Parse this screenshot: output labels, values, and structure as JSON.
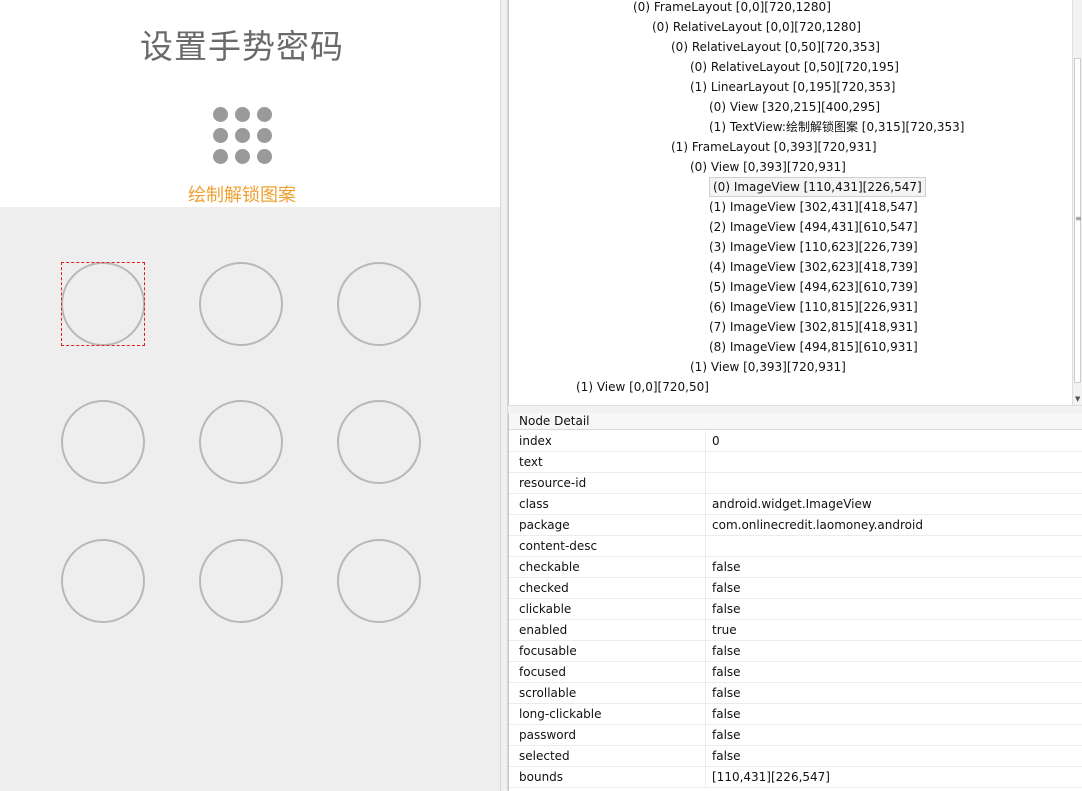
{
  "device": {
    "title": "设置手势密码",
    "hint": "绘制解锁图案",
    "pattern_nodes": 9,
    "colors": {
      "hint": "#f0a033",
      "title": "#6a6a6a",
      "node_border": "#b8b8b8",
      "pattern_bg": "#eeeeee",
      "selection": "#e02020"
    }
  },
  "tree": {
    "lines": [
      {
        "text": "(0) FrameLayout [0,0][720,1280]"
      },
      {
        "text": "(0) RelativeLayout [0,0][720,1280]"
      },
      {
        "text": "(0) RelativeLayout [0,50][720,353]"
      },
      {
        "text": "(0) RelativeLayout [0,50][720,195]"
      },
      {
        "text": "(1) LinearLayout [0,195][720,353]"
      },
      {
        "text": "(0) View [320,215][400,295]"
      },
      {
        "text": "(1) TextView:绘制解锁图案 [0,315][720,353]"
      },
      {
        "text": "(1) FrameLayout [0,393][720,931]"
      },
      {
        "text": "(0) View [0,393][720,931]"
      },
      {
        "text": "(0) ImageView [110,431][226,547]",
        "selected": true
      },
      {
        "text": "(1) ImageView [302,431][418,547]"
      },
      {
        "text": "(2) ImageView [494,431][610,547]"
      },
      {
        "text": "(3) ImageView [110,623][226,739]"
      },
      {
        "text": "(4) ImageView [302,623][418,739]"
      },
      {
        "text": "(5) ImageView [494,623][610,739]"
      },
      {
        "text": "(6) ImageView [110,815][226,931]"
      },
      {
        "text": "(7) ImageView [302,815][418,931]"
      },
      {
        "text": "(8) ImageView [494,815][610,931]"
      },
      {
        "text": "(1) View [0,393][720,931]"
      },
      {
        "text": "(1) View [0,0][720,50]"
      }
    ]
  },
  "detail": {
    "header": "Node Detail",
    "rows": [
      {
        "key": "index",
        "value": "0"
      },
      {
        "key": "text",
        "value": ""
      },
      {
        "key": "resource-id",
        "value": ""
      },
      {
        "key": "class",
        "value": "android.widget.ImageView"
      },
      {
        "key": "package",
        "value": "com.onlinecredit.laomoney.android"
      },
      {
        "key": "content-desc",
        "value": ""
      },
      {
        "key": "checkable",
        "value": "false"
      },
      {
        "key": "checked",
        "value": "false"
      },
      {
        "key": "clickable",
        "value": "false"
      },
      {
        "key": "enabled",
        "value": "true"
      },
      {
        "key": "focusable",
        "value": "false"
      },
      {
        "key": "focused",
        "value": "false"
      },
      {
        "key": "scrollable",
        "value": "false"
      },
      {
        "key": "long-clickable",
        "value": "false"
      },
      {
        "key": "password",
        "value": "false"
      },
      {
        "key": "selected",
        "value": "false"
      },
      {
        "key": "bounds",
        "value": "[110,431][226,547]"
      }
    ]
  }
}
